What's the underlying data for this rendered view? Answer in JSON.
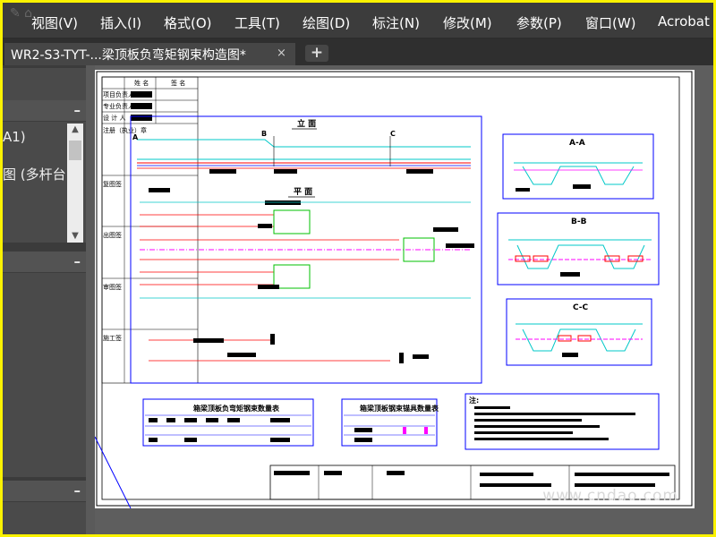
{
  "menu": {
    "items": [
      "视图(V)",
      "插入(I)",
      "格式(O)",
      "工具(T)",
      "绘图(D)",
      "标注(N)",
      "修改(M)",
      "参数(P)",
      "窗口(W)",
      "Acrobat"
    ]
  },
  "document_tab": {
    "title": "WR2-S3-TYT-...梁顶板负弯矩钢束构造图*",
    "close_label": "×",
    "add_label": "+"
  },
  "left_panel": {
    "line1": "A1)",
    "line2": "图 (多杆台"
  },
  "drawing": {
    "title_block_labels": [
      "项目负责人",
      "专业负责人",
      "设 计 人",
      "注册（执业）章",
      "复图签",
      "出图签",
      "审图签",
      "施工签"
    ],
    "title_block_headers": [
      "姓 名",
      "签 名"
    ],
    "elevation_title": "立 面",
    "plan_title": "平 面",
    "section_a": "A-A",
    "section_b": "B-B",
    "section_c": "C-C",
    "section_letters": [
      "A",
      "B",
      "C"
    ],
    "table1_title": "箱梁顶板负弯矩钢束数量表",
    "table2_title": "箱梁顶板钢束锚具数量表",
    "notes_title": "注:",
    "watermark": "www.cndao.com"
  },
  "colors": {
    "accent_blue": "#0000ff",
    "cyan": "#00c8c8",
    "magenta": "#ff00ff",
    "red": "#ff0000",
    "green": "#00c000",
    "yellow_border": "#fbf200"
  }
}
